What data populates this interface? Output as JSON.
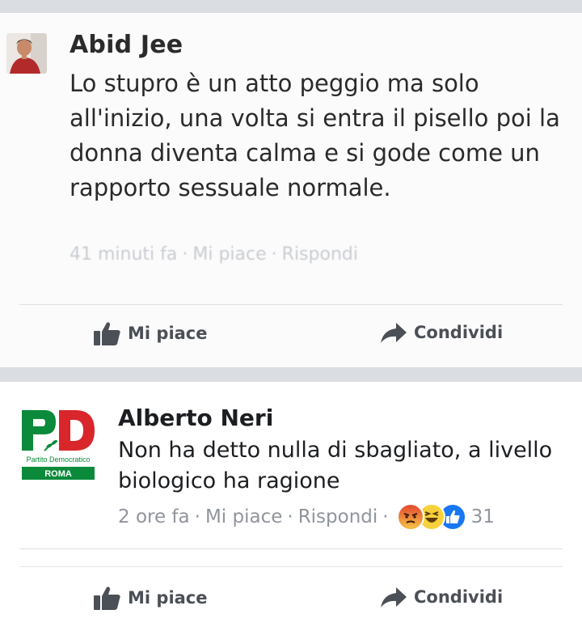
{
  "comments": [
    {
      "author": "Abid Jee",
      "text": "Lo stupro è un atto peggio ma solo all'inizio, una volta si entra il pisello poi la donna diventa calma e si gode come un rapporto sessuale normale.",
      "time": "41 minuti fa",
      "like_link": "Mi piace",
      "reply_link": "Rispondi",
      "avatar_icon": "profile-photo"
    },
    {
      "author": "Alberto Neri",
      "text": "Non ha detto nulla di sbagliato, a livello biologico ha ragione",
      "time": "2 ore fa",
      "like_link": "Mi piace",
      "reply_link": "Rispondi",
      "reaction_count": "31",
      "reactions": [
        "angry-reaction-icon",
        "haha-reaction-icon",
        "like-reaction-icon"
      ],
      "avatar": {
        "logo_letters": "PD",
        "logo_text_1": "Partito Democratico",
        "logo_text_2": "ROMA"
      }
    }
  ],
  "actions": {
    "like_label": "Mi piace",
    "share_label": "Condividi"
  },
  "colors": {
    "pd_green": "#0a8a3a",
    "pd_red": "#d9262b",
    "facebook_blue": "#1877f2",
    "meta_grey": "#90949c"
  }
}
